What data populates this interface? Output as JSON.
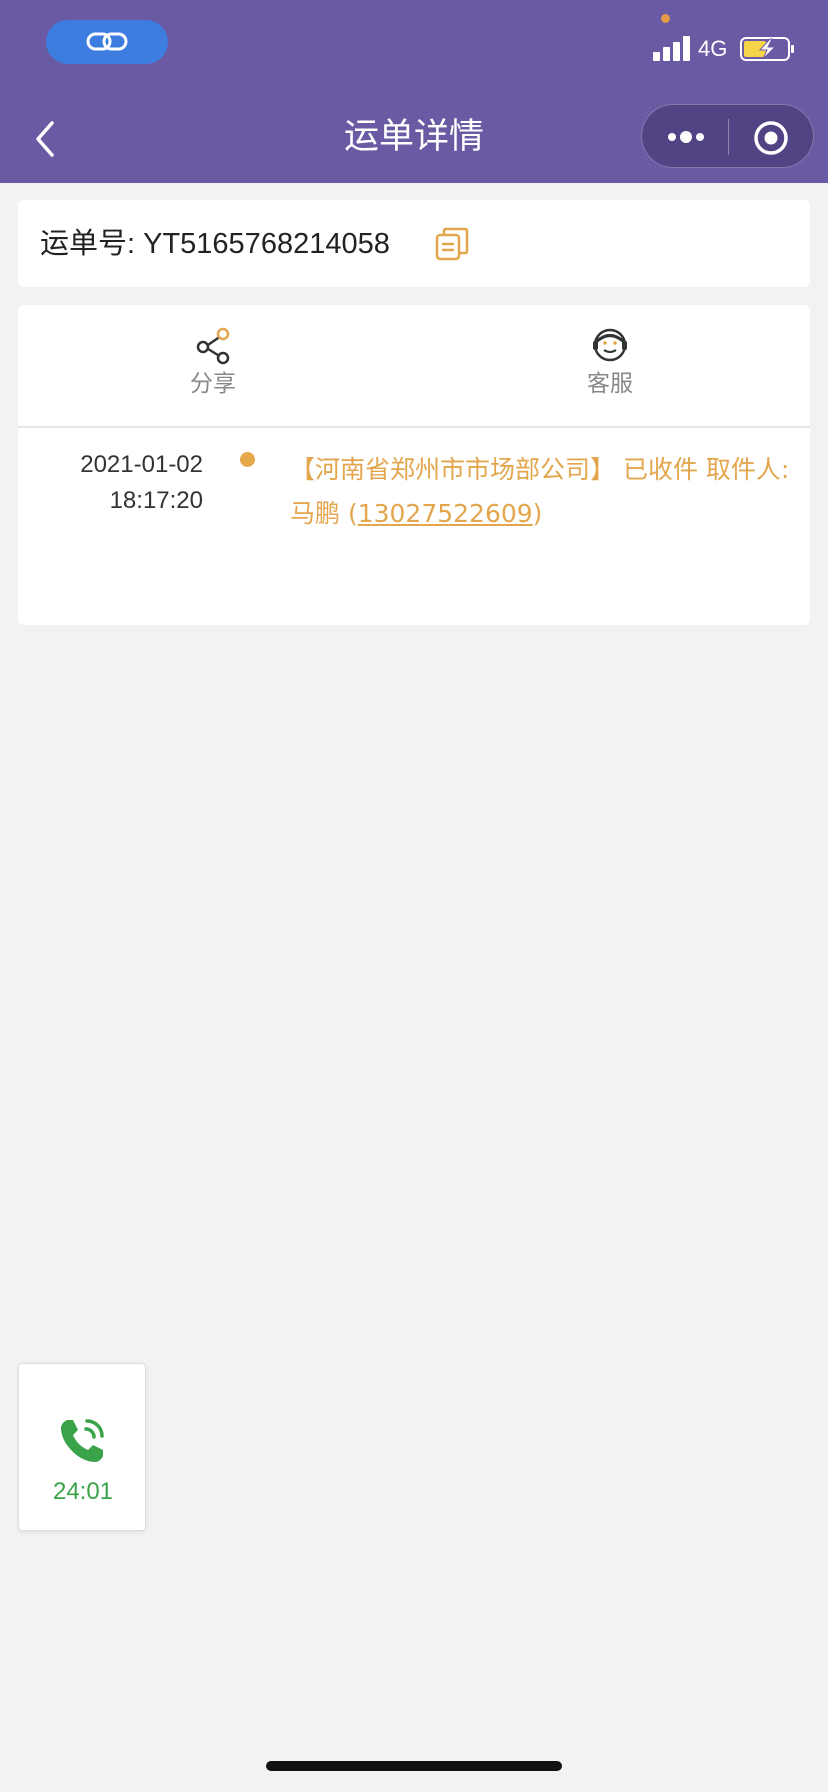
{
  "status_bar": {
    "network": "4G",
    "battery_color": "#f6d44a"
  },
  "nav": {
    "title": "运单详情",
    "back_icon": "chevron-left-icon",
    "more_icon": "more-dots-icon",
    "close_icon": "target-icon"
  },
  "waybill": {
    "label": "运单号: YT5165768214058",
    "copy_icon": "copy-icon"
  },
  "actions": [
    {
      "label": "分享",
      "icon": "share-icon"
    },
    {
      "label": "客服",
      "icon": "customer-service-icon"
    }
  ],
  "timeline": [
    {
      "date": "2021-01-02",
      "time": "18:17:20",
      "text_prefix": "【河南省郑州市市场部公司】 已收件 取件人: 马鹏 (",
      "phone": "13027522609",
      "text_suffix": ")"
    }
  ],
  "call_widget": {
    "icon": "phone-ringing-icon",
    "duration": "24:01"
  },
  "colors": {
    "header": "#6a5aa3",
    "accent": "#e3a64d",
    "call_green": "#3aa34a"
  }
}
